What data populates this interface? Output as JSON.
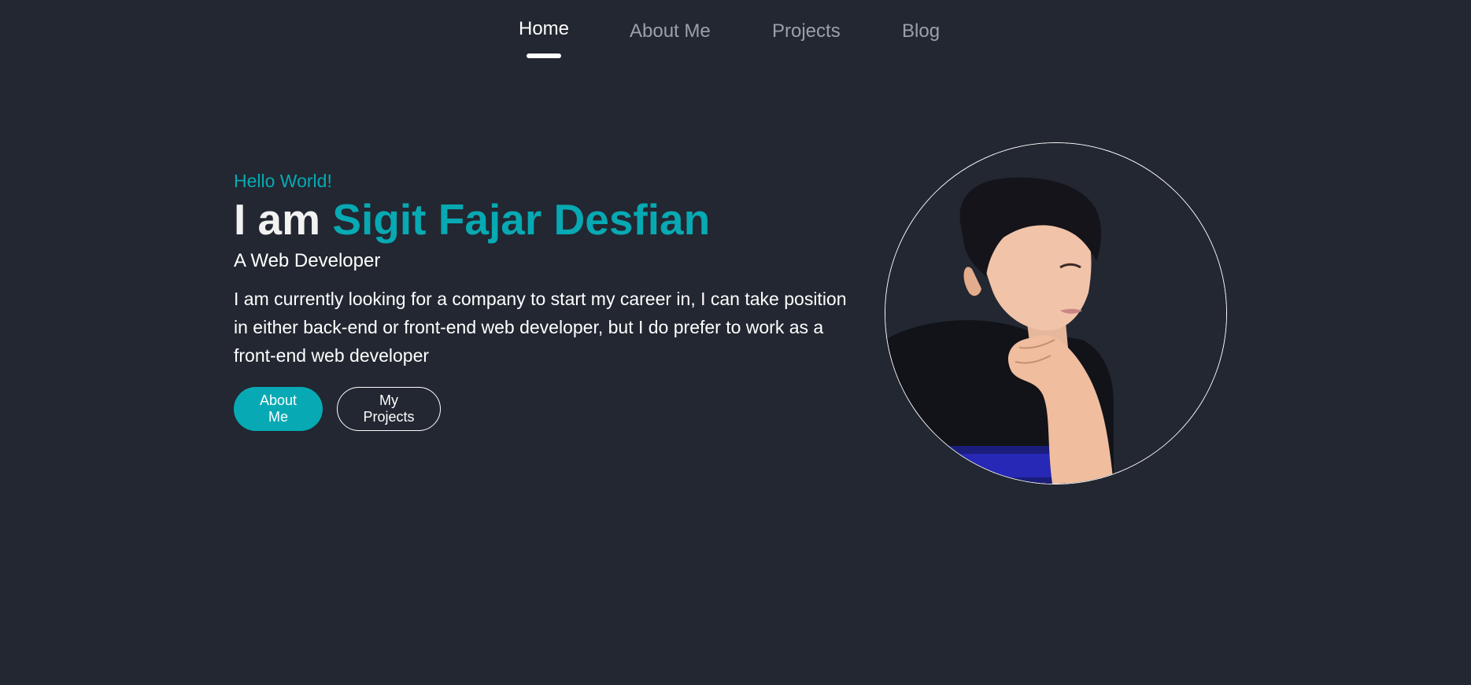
{
  "nav": {
    "items": [
      {
        "label": "Home",
        "active": true
      },
      {
        "label": "About Me",
        "active": false
      },
      {
        "label": "Projects",
        "active": false
      },
      {
        "label": "Blog",
        "active": false
      }
    ]
  },
  "hero": {
    "greeting": "Hello World!",
    "headline_prefix": "I am ",
    "name": "Sigit Fajar Desfian",
    "role": "A Web Developer",
    "bio": "I am currently looking for a company to start my career in, I can take position in either back-end or front-end web developer, but I do prefer to work as a front-end web developer",
    "buttons": {
      "primary_label": "About Me",
      "secondary_label": "My Projects"
    }
  },
  "colors": {
    "background": "#222731",
    "accent": "#07aab4",
    "nav_inactive": "#9ba0a8",
    "text": "#ffffff"
  }
}
